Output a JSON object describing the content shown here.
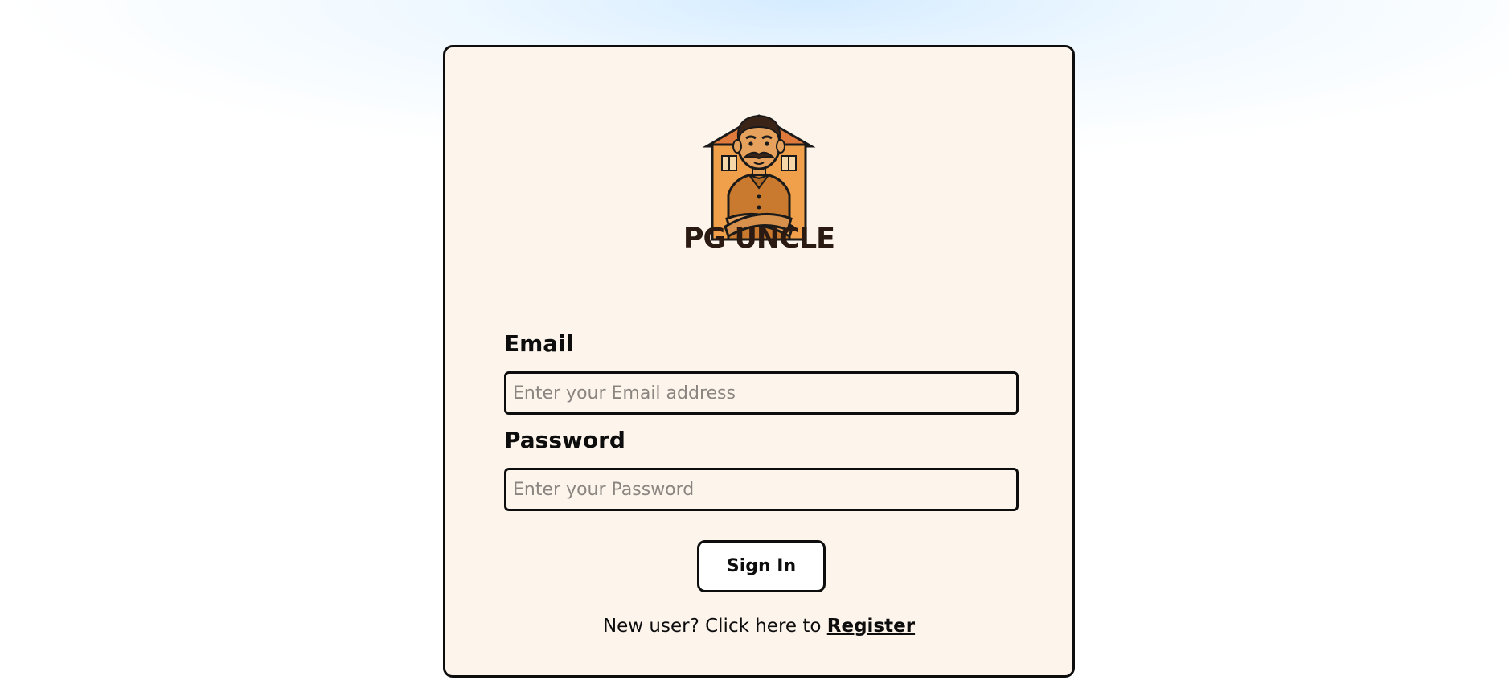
{
  "brand": {
    "name": "PG UNCLE",
    "logo_icon": "landlord-mascot-house-icon"
  },
  "login": {
    "email_label": "Email",
    "email_placeholder": "Enter your Email address",
    "email_value": "",
    "password_label": "Password",
    "password_placeholder": "Enter your Password",
    "password_value": "",
    "submit_label": "Sign In",
    "register_prompt": "New user? Click here to ",
    "register_link": "Register"
  },
  "colors": {
    "card_background": "#fdf4ec",
    "border": "#0d0d0d",
    "brand_text": "#2a1a12",
    "logo_orange": "#f0a04b",
    "logo_roof": "#e07a3c",
    "logo_shirt": "#c97a2e"
  }
}
